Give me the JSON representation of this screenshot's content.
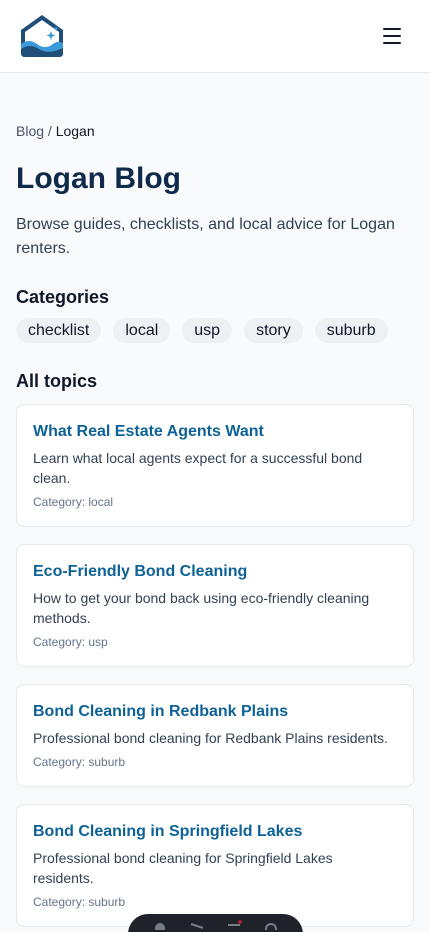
{
  "header": {
    "logo_icon": "house-wave-sparkle-logo",
    "menu_icon": "hamburger-menu-icon"
  },
  "breadcrumb": {
    "parent": "Blog",
    "separator": "/",
    "current": "Logan"
  },
  "page": {
    "title": "Logan Blog",
    "intro": "Browse guides, checklists, and local advice for Logan renters."
  },
  "categories": {
    "heading": "Categories",
    "items": [
      "checklist",
      "local",
      "usp",
      "story",
      "suburb"
    ]
  },
  "topics": {
    "heading": "All topics",
    "cards": [
      {
        "title": "What Real Estate Agents Want",
        "description": "Learn what local agents expect for a successful bond clean.",
        "category": "Category: local"
      },
      {
        "title": "Eco-Friendly Bond Cleaning",
        "description": "How to get your bond back using eco-friendly cleaning methods.",
        "category": "Category: usp"
      },
      {
        "title": "Bond Cleaning in Redbank Plains",
        "description": "Professional bond cleaning for Redbank Plains residents.",
        "category": "Category: suburb"
      },
      {
        "title": "Bond Cleaning in Springfield Lakes",
        "description": "Professional bond cleaning for Springfield Lakes residents.",
        "category": "Category: suburb"
      }
    ]
  },
  "colors": {
    "title": "#0f2a4a",
    "link": "#0e6296",
    "logo_dark": "#1f4e79",
    "logo_light": "#3b9ad9"
  }
}
